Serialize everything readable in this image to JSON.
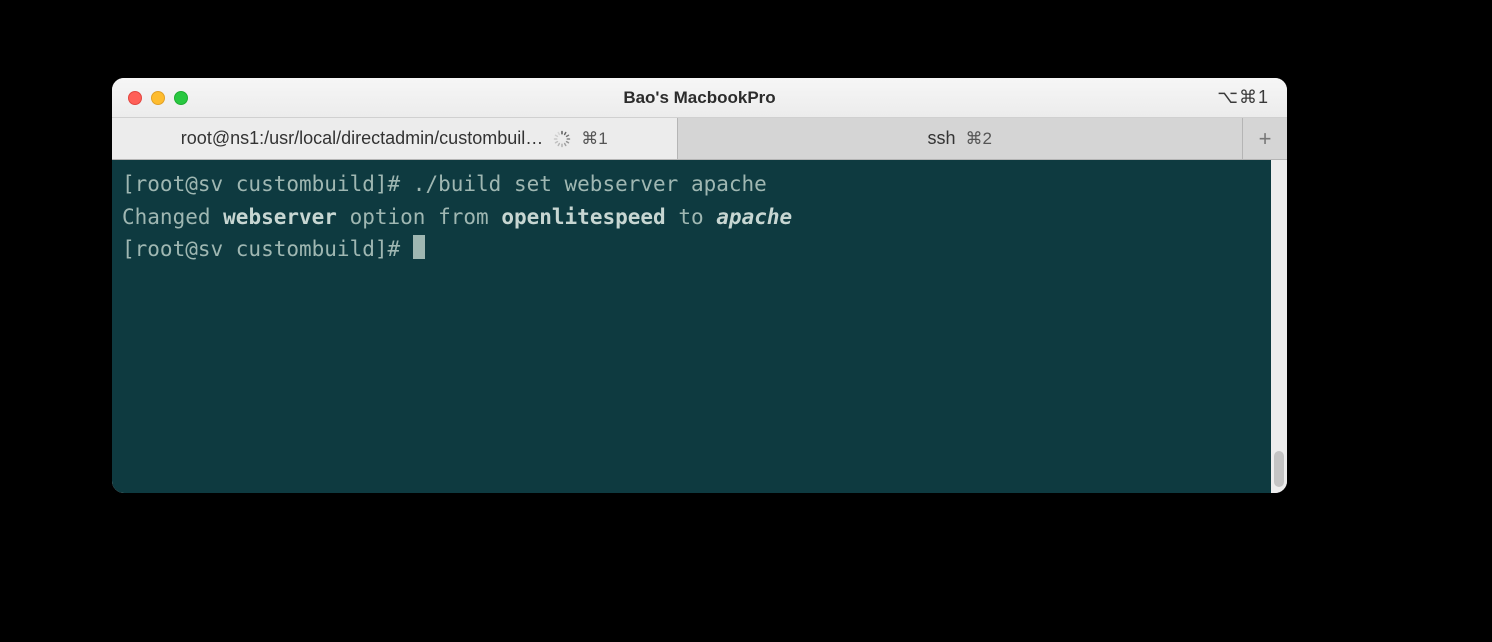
{
  "window": {
    "title": "Bao's MacbookPro",
    "shortcutIndicator": "⌥⌘1"
  },
  "tabs": [
    {
      "label": "root@ns1:/usr/local/directadmin/custombuil…",
      "shortcut": "⌘1",
      "active": true,
      "loading": true
    },
    {
      "label": "ssh",
      "shortcut": "⌘2",
      "active": false,
      "loading": false
    }
  ],
  "terminal": {
    "prompt1": "[root@sv custombuild]# ",
    "command1": "./build set webserver apache",
    "line2_prefix": "Changed ",
    "line2_bold1": "webserver",
    "line2_mid": " option from ",
    "line2_bold2": "openlitespeed",
    "line2_to": " to ",
    "line2_bolditalic": "apache",
    "prompt2": "[root@sv custombuild]# "
  }
}
